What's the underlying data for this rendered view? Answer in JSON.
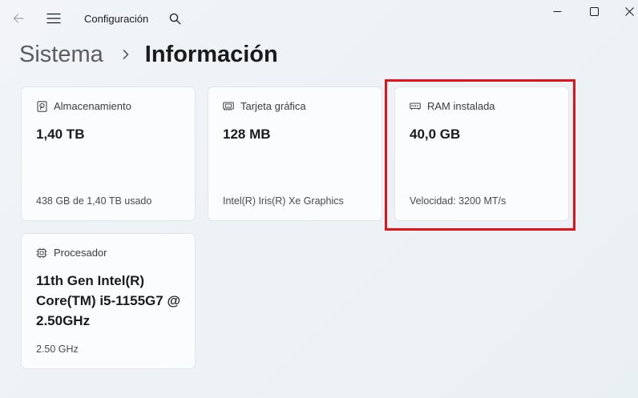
{
  "titlebar": {
    "app_title": "Configuración",
    "back_icon": "arrow-left-icon",
    "menu_icon": "hamburger-menu-icon",
    "search_icon": "search-icon",
    "window_controls": [
      "minimize-icon",
      "maximize-icon",
      "close-icon"
    ]
  },
  "breadcrumb": {
    "parent": "Sistema",
    "separator_icon": "chevron-right-icon",
    "current": "Información"
  },
  "cards": [
    {
      "icon": "hard-drive-icon",
      "label": "Almacenamiento",
      "value": "1,40 TB",
      "detail": "438 GB de 1,40 TB usado"
    },
    {
      "icon": "graphics-card-icon",
      "label": "Tarjeta gráfica",
      "value": "128 MB",
      "detail": "Intel(R) Iris(R) Xe Graphics"
    },
    {
      "icon": "memory-icon",
      "label": "RAM instalada",
      "value": "40,0 GB",
      "detail": "Velocidad: 3200 MT/s"
    },
    {
      "icon": "processor-icon",
      "label": "Procesador",
      "value": "11th Gen Intel(R) Core(TM) i5-1155G7 @ 2.50GHz",
      "detail": "2.50 GHz"
    }
  ],
  "colors": {
    "highlight": "#e0131b",
    "card_background": "#fbfcfd",
    "card_border": "#e3e6e9"
  }
}
